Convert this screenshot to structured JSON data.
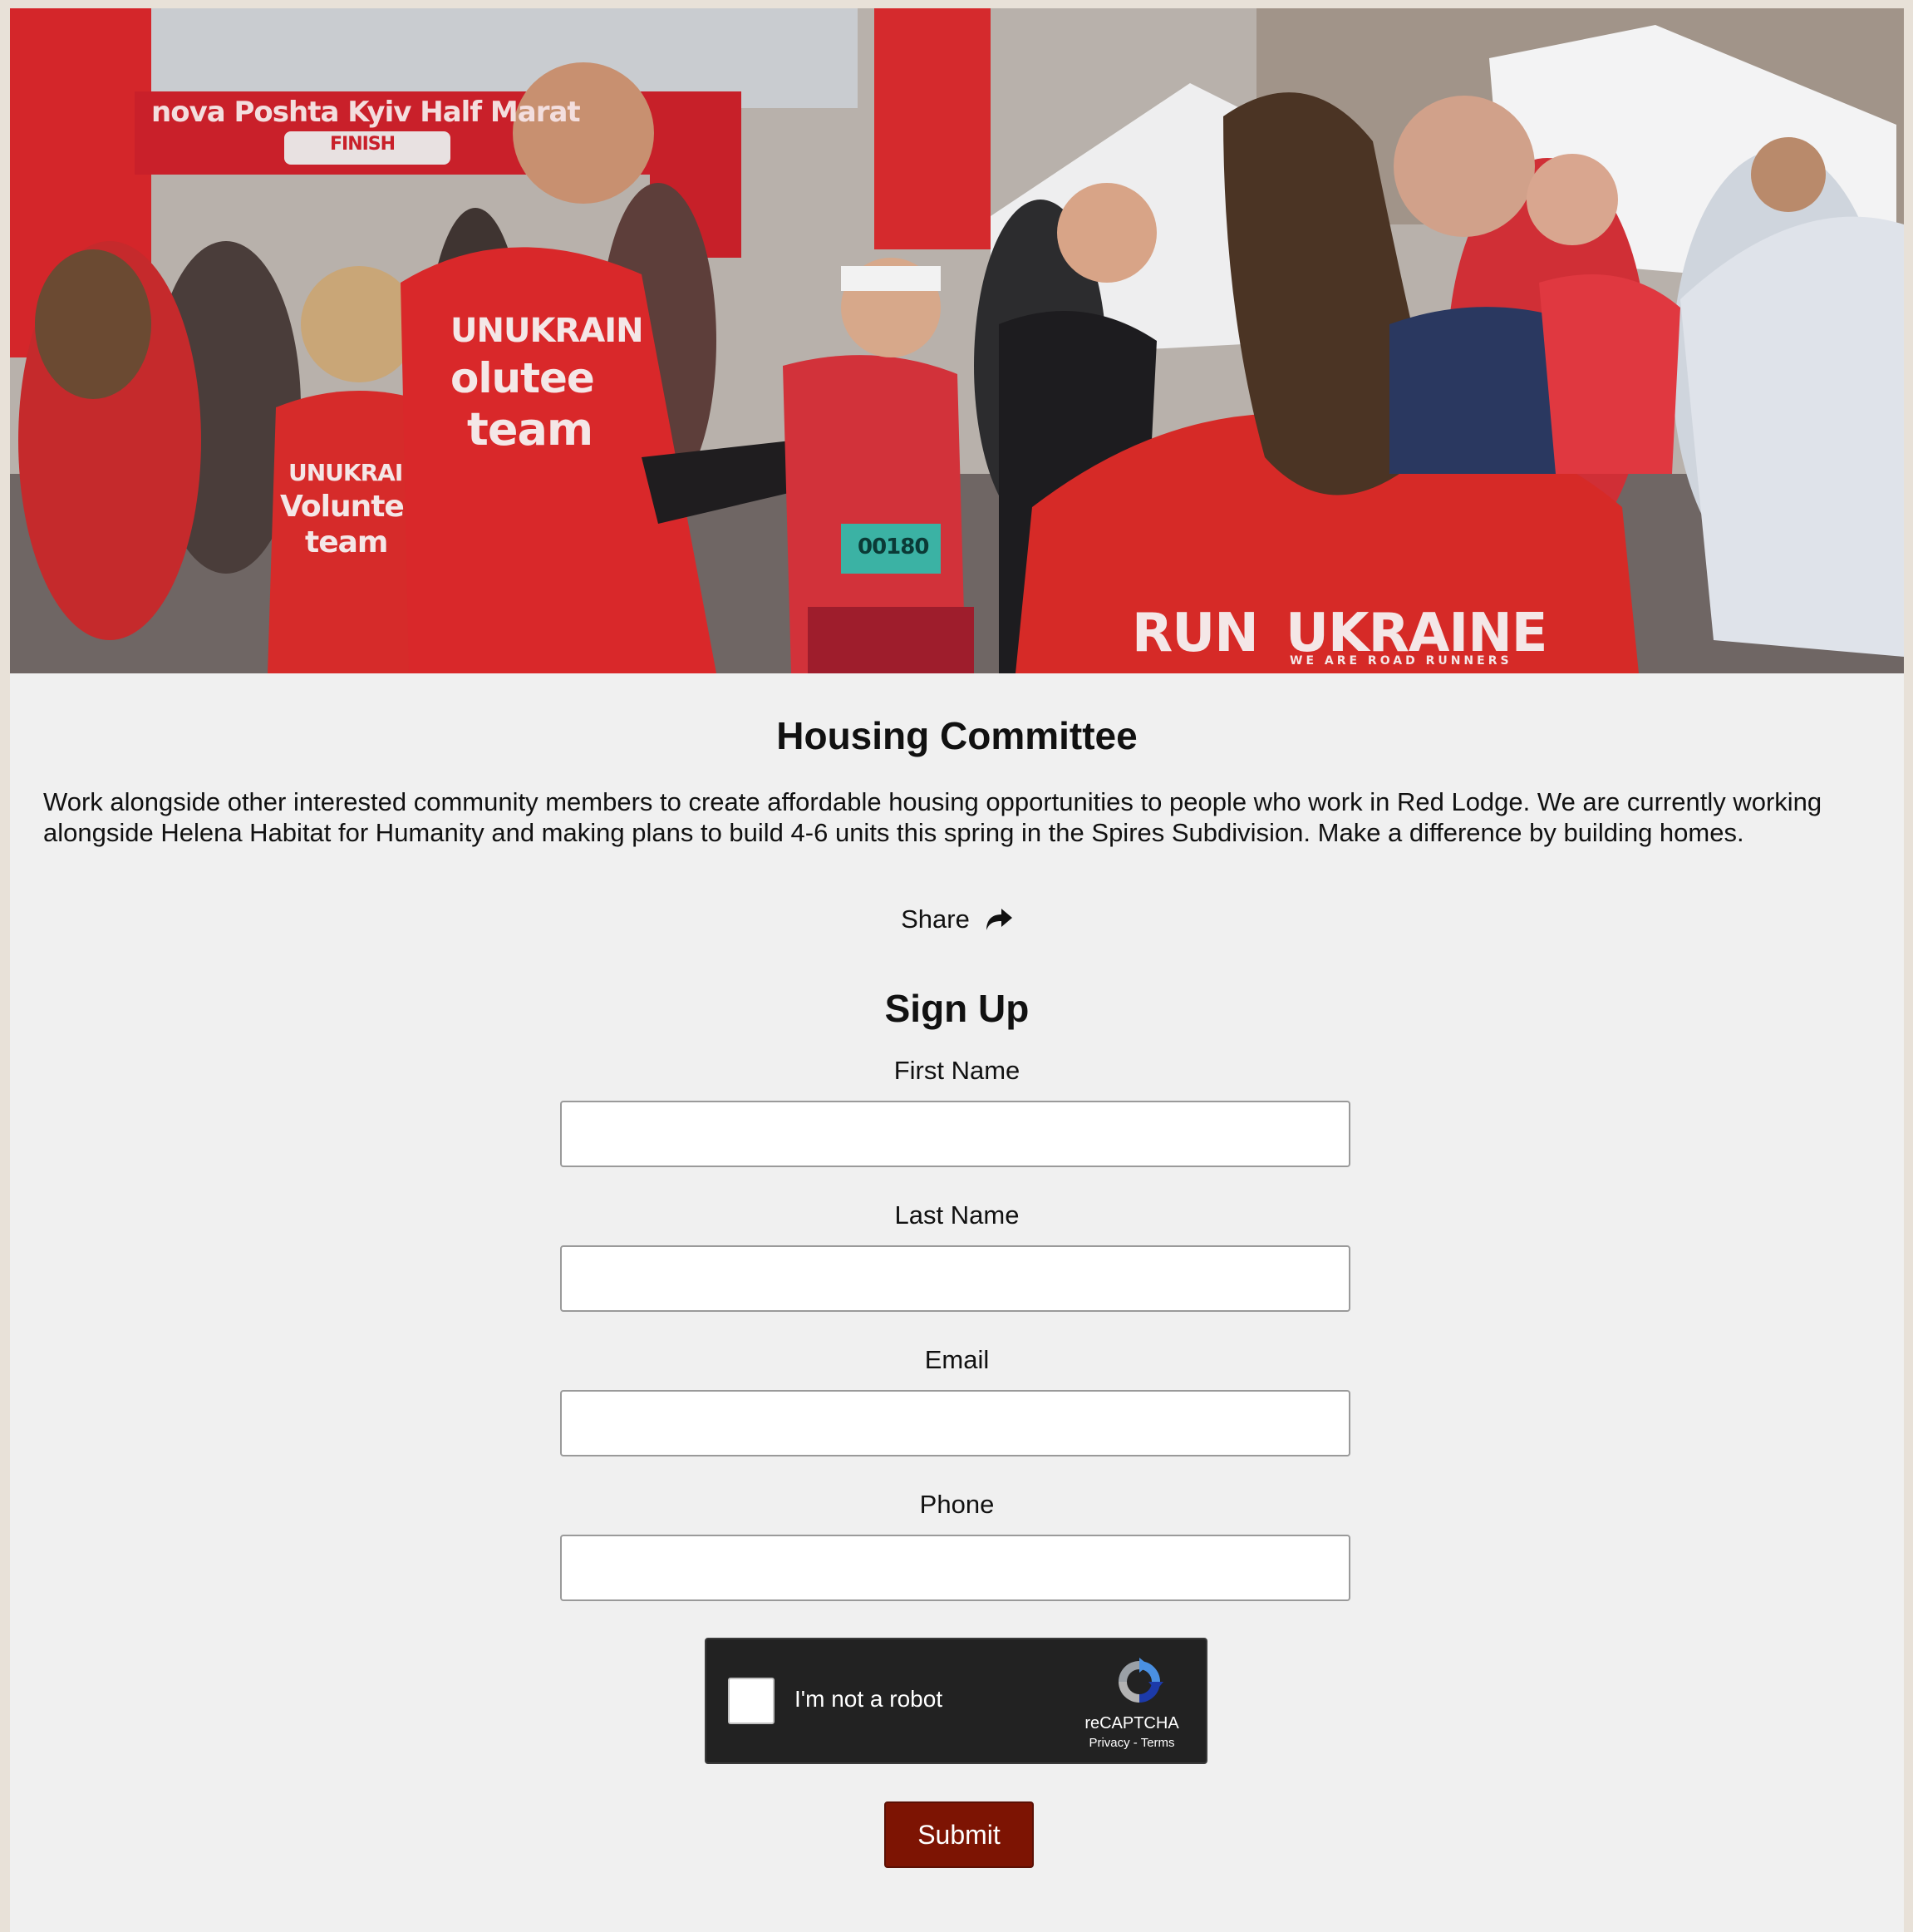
{
  "hero": {
    "shirt_texts": [
      "UNUKRAIN",
      "olutee",
      "team",
      "UNUKRAI",
      "Volunte",
      "team",
      "RUN",
      "UKRAINE",
      "WE ARE ROAD RUNNERS",
      "nova Poshta Kyiv Half Marat",
      "FINISH",
      "00180"
    ]
  },
  "title": "Housing Committee",
  "description": "Work alongside other interested community members to create affordable housing opportunities to people who work in Red Lodge. We are currently working alongside Helena Habitat for Humanity and making plans to build 4-6 units this spring in the Spires Subdivision. Make a difference by building homes.",
  "share": {
    "label": "Share",
    "icon": "share-arrow-icon"
  },
  "signup": {
    "title": "Sign Up",
    "fields": {
      "first_name": {
        "label": "First Name",
        "value": "",
        "placeholder": ""
      },
      "last_name": {
        "label": "Last Name",
        "value": "",
        "placeholder": ""
      },
      "email": {
        "label": "Email",
        "value": "",
        "placeholder": ""
      },
      "phone": {
        "label": "Phone",
        "value": "",
        "placeholder": ""
      }
    },
    "captcha": {
      "label": "I'm not a robot",
      "brand": "reCAPTCHA",
      "privacy": "Privacy",
      "separator": " - ",
      "terms": "Terms"
    },
    "submit_label": "Submit"
  },
  "colors": {
    "page_background": "#f0f0f0",
    "outer_background": "#e8e1d8",
    "submit_button": "#7d1403",
    "captcha_background": "#222222",
    "shirt_red": "#d42a25"
  }
}
